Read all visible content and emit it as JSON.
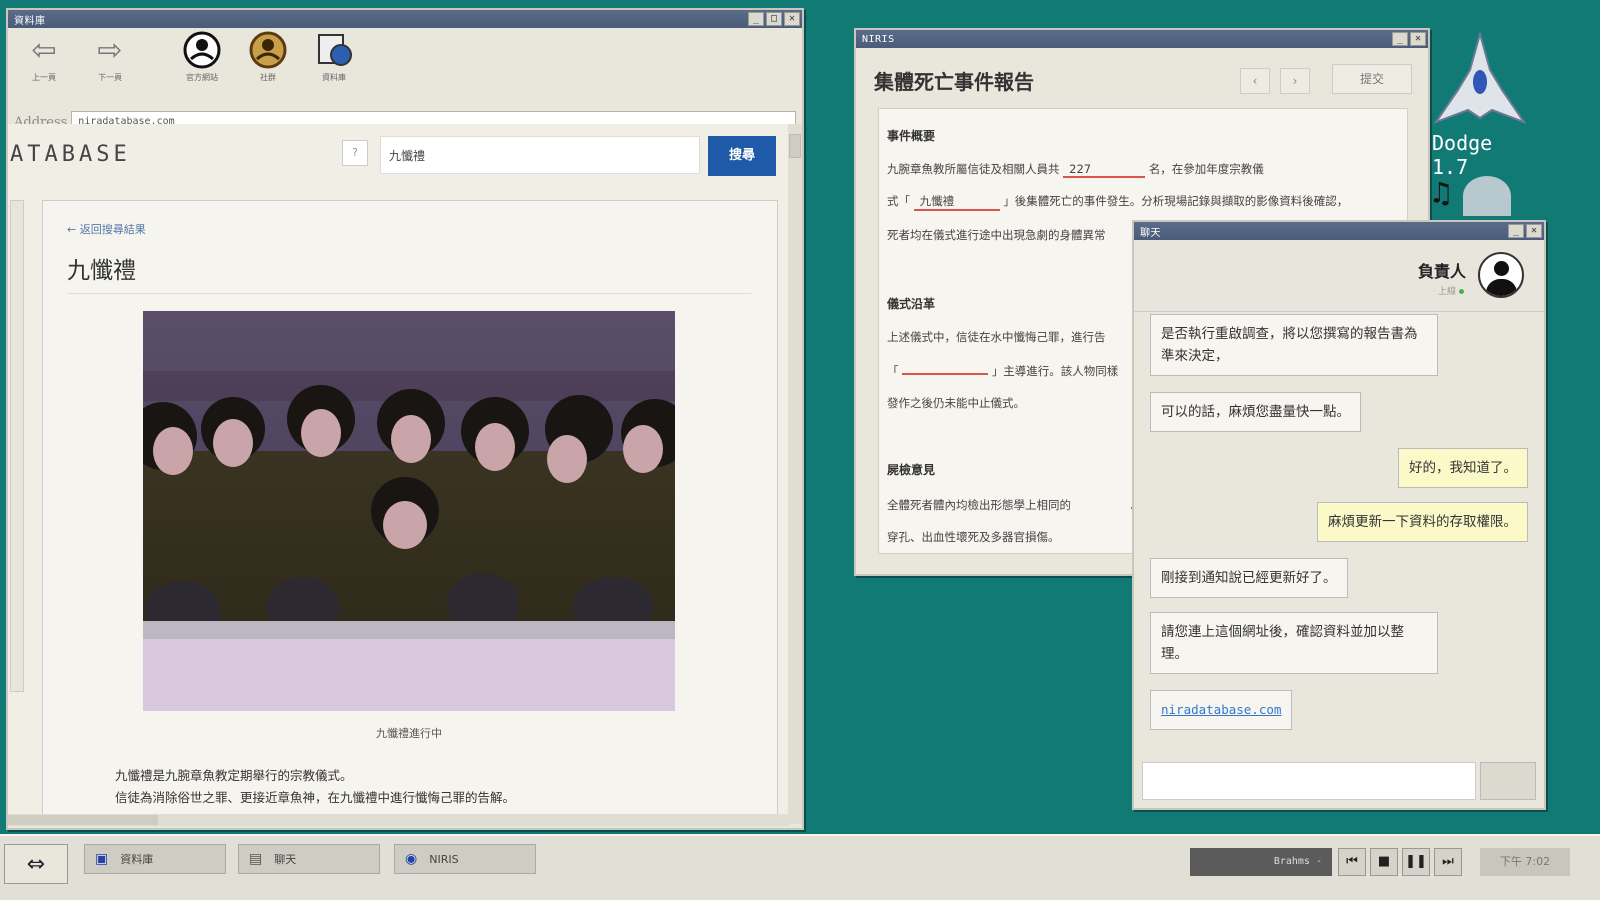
{
  "colors": {
    "desktop": "#127a75",
    "accent": "#1e5aa8",
    "error_underline": "#d9534f",
    "chat_out_bg": "#fcf9c8"
  },
  "desktop": {
    "dodge_label": "Dodge 1.7",
    "music_icon": "music-note-icon"
  },
  "browser": {
    "title": "資料庫",
    "toolbar": {
      "back_label": "上一頁",
      "forward_label": "下一頁",
      "official_label": "官方網站",
      "community_label": "社群",
      "database_label": "資料庫"
    },
    "address_label": "Address",
    "address_value": "niradatabase.com",
    "site_logo": "ATABASE",
    "help_label": "?",
    "search_value": "九懺禮",
    "search_button": "搜尋",
    "back_link": "← 返回搜尋結果",
    "page_title": "九懺禮",
    "photo_caption": "九懺禮進行中",
    "paragraphs": [
      "九懺禮是九腕章魚教定期舉行的宗教儀式。",
      "信徒為消除俗世之罪、更接近章魚神，在九懺禮中進行懺悔己罪的告解。"
    ]
  },
  "niris": {
    "title": "NIRIS",
    "report_title": "集體死亡事件報告",
    "prev": "‹",
    "next": "›",
    "submit": "提交",
    "sections": {
      "summary": {
        "heading": "事件概要",
        "line1_pre": "九腕章魚教所屬信徒及相關人員共",
        "line1_blank": "227",
        "line1_post": "名，在參加年度宗教儀",
        "line2_pre": "式「",
        "line2_blank": "九懺禮",
        "line2_post": "」後集體死亡的事件發生。分析現場記錄與擷取的影像資料後確認，",
        "line3": "死者均在儀式進行途中出現急劇的身體異常"
      },
      "history": {
        "heading": "儀式沿革",
        "line1": "上述儀式中，信徒在水中懺悔己罪，進行告",
        "line2_pre": "「",
        "line2_post": "」主導進行。該人物同樣",
        "line3": "發作之後仍未能中止儀式。"
      },
      "autopsy": {
        "heading": "屍檢意見",
        "line1": "全體死者體內均檢出形態學上相同的",
        "line2": "穿孔、出血性壞死及多器官損傷。"
      }
    }
  },
  "chat": {
    "title": "聊天",
    "contact_name": "負責人",
    "contact_status": "上線",
    "messages": [
      {
        "dir": "in",
        "text": "是否執行重啟調查，將以您撰寫的報告書為準來決定，"
      },
      {
        "dir": "in",
        "text": "可以的話，麻煩您盡量快一點。"
      },
      {
        "dir": "out",
        "text": "好的，我知道了。"
      },
      {
        "dir": "out",
        "text": "麻煩更新一下資料的存取權限。"
      },
      {
        "dir": "in",
        "text": "剛接到通知說已經更新好了。"
      },
      {
        "dir": "in",
        "text": "請您連上這個網址後，確認資料並加以整理。"
      },
      {
        "dir": "in",
        "text": "niradatabase.com"
      }
    ]
  },
  "taskbar": {
    "tasks": [
      "資料庫",
      "聊天",
      "NIRIS"
    ],
    "music_track": "Brahms -",
    "clock": "下午 7:02"
  }
}
